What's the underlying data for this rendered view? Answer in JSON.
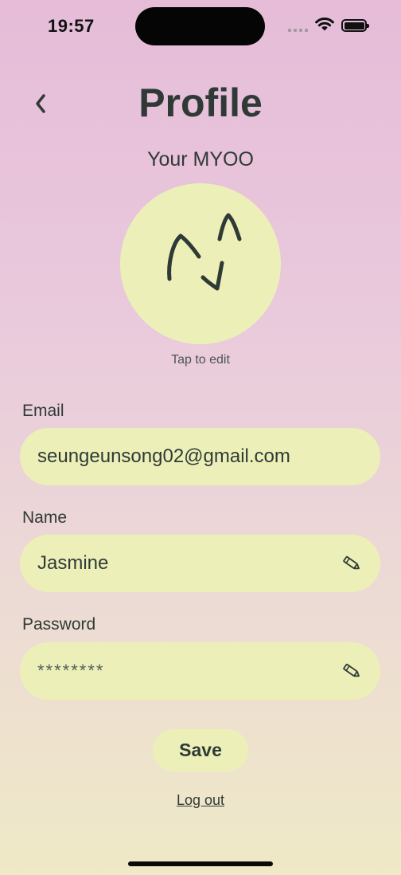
{
  "status_bar": {
    "time": "19:57",
    "icons": [
      "cellular-signal-icon",
      "wifi-icon",
      "battery-icon"
    ]
  },
  "header": {
    "back_icon": "chevron-left-icon",
    "title": "Profile"
  },
  "avatar": {
    "caption": "Your MYOO",
    "hint": "Tap to edit",
    "background_color": "#ecf0b8",
    "stroke_color": "#2f3a36"
  },
  "form": {
    "email": {
      "label": "Email",
      "value": "seungeunsong02@gmail.com"
    },
    "name": {
      "label": "Name",
      "value": "Jasmine",
      "edit_icon": "pencil-icon"
    },
    "password": {
      "label": "Password",
      "value": "********",
      "edit_icon": "pencil-icon"
    }
  },
  "actions": {
    "save_label": "Save",
    "logout_label": "Log out"
  },
  "colors": {
    "field_background": "#ecf0b8",
    "text": "#2f3a36",
    "gradient_top": "#e6bcd8",
    "gradient_bottom": "#efe9c6"
  }
}
